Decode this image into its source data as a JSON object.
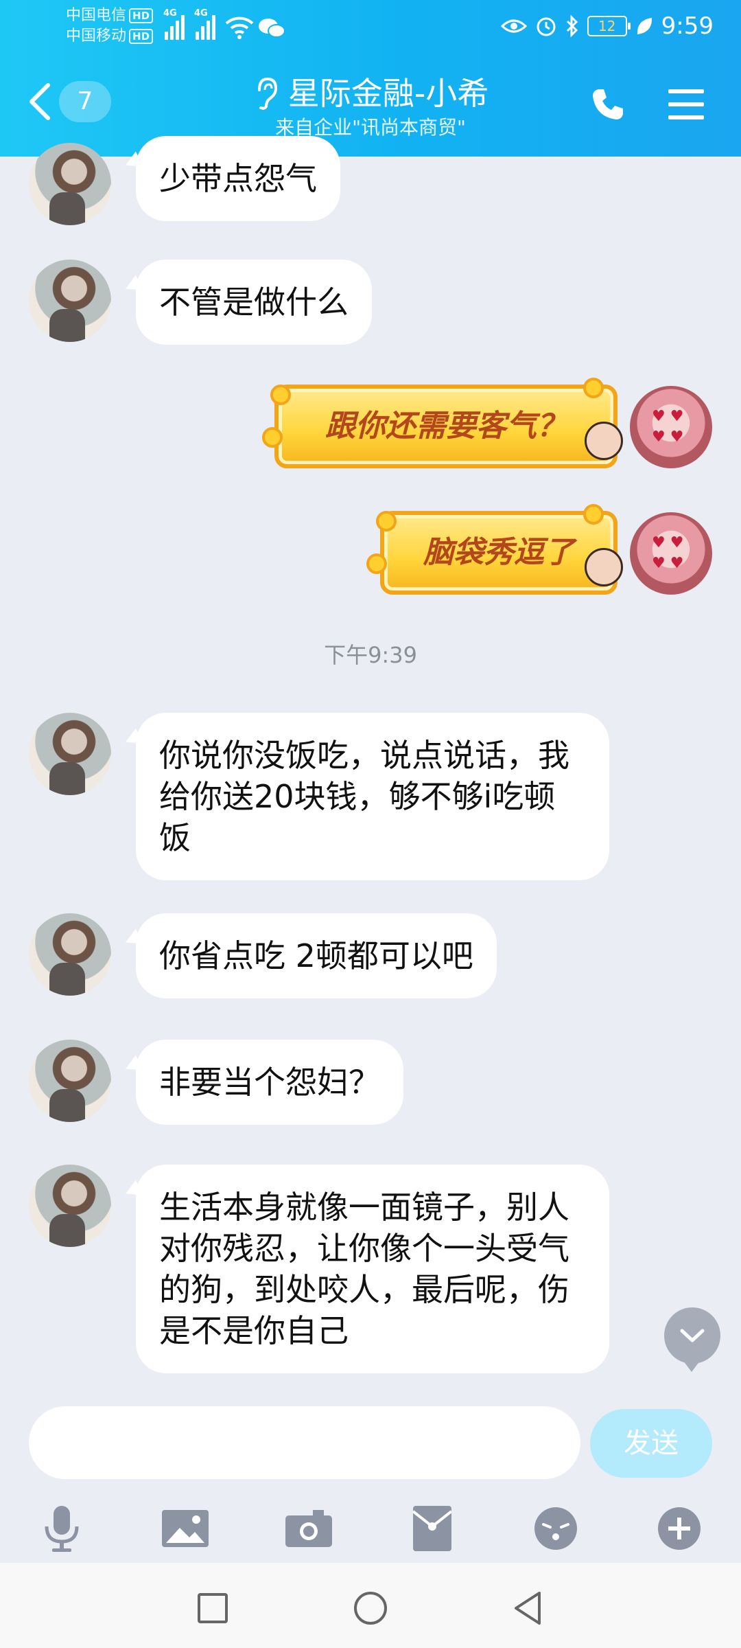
{
  "status_bar": {
    "carrier1": "中国电信",
    "carrier2": "中国移动",
    "hd": "HD",
    "net1": "4G",
    "net2": "4G",
    "battery": "12",
    "time": "9:59"
  },
  "header": {
    "unread_count": "7",
    "title": "星际金融-小希",
    "subtitle": "来自企业\"讯尚本商贸\""
  },
  "messages": [
    {
      "from": "other",
      "text": "少带点怨气"
    },
    {
      "from": "other",
      "text": "不管是做什么"
    },
    {
      "from": "me",
      "sticker": "跟你还需要客气？"
    },
    {
      "from": "me",
      "sticker": "脑袋秀逗了"
    },
    {
      "timestamp": "下午9:39"
    },
    {
      "from": "other",
      "text": "你说你没饭吃，说点说话，我给你送20块钱，够不够i吃顿饭"
    },
    {
      "from": "other",
      "text": "你省点吃 2顿都可以吧"
    },
    {
      "from": "other",
      "text": "非要当个怨妇？"
    },
    {
      "from": "other",
      "text": "生活本身就像一面镜子，别人对你残忍，让你像个一头受气的狗，到处咬人，最后呢，伤是不是你自己"
    }
  ],
  "input": {
    "value": "",
    "send_label": "发送"
  },
  "toolbar": [
    "microphone-icon",
    "image-icon",
    "camera-icon",
    "red-packet-icon",
    "emoji-icon",
    "plus-icon"
  ],
  "colors": {
    "header": "#12b2f2",
    "background": "#eaedf4",
    "bubble": "#ffffff",
    "send_button": "#b3eafc"
  }
}
